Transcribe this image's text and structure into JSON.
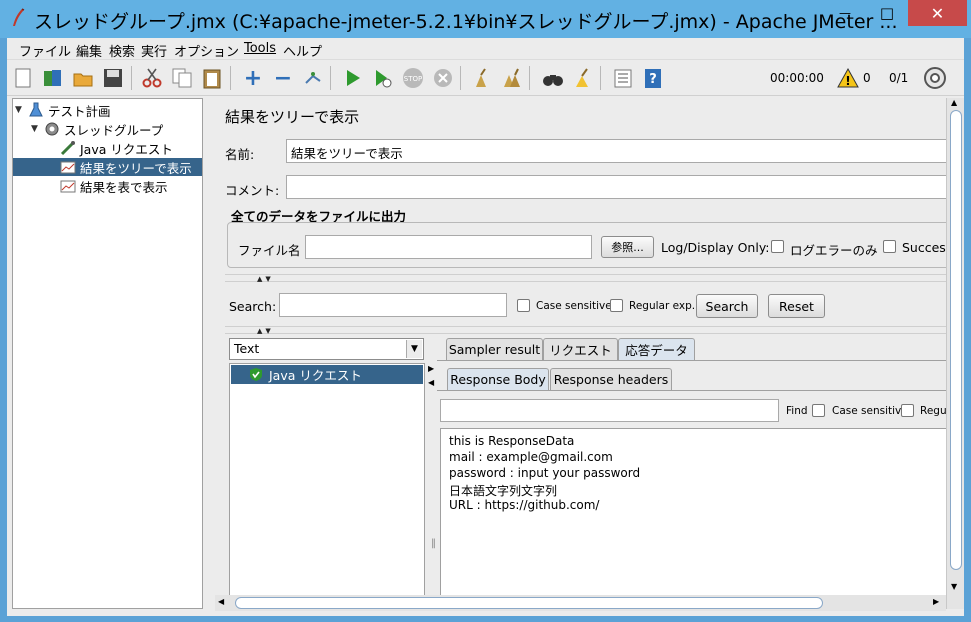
{
  "window": {
    "title": "スレッドグループ.jmx (C:¥apache-jmeter-5.2.1¥bin¥スレッドグループ.jmx) - Apache JMeter ...",
    "minimize": "—",
    "maximize": "□",
    "close": "✕"
  },
  "menu": [
    "ファイル",
    "編集",
    "検索",
    "実行",
    "オプション",
    "Tools",
    "ヘルプ"
  ],
  "toolbar": {
    "timer": "00:00:00",
    "warnings": "0",
    "threads": "0/1"
  },
  "tree": {
    "items": [
      {
        "label": "テスト計画",
        "icon": "flask-icon"
      },
      {
        "label": "スレッドグループ",
        "icon": "gear-icon"
      },
      {
        "label": "Java リクエスト",
        "icon": "pipette-icon"
      },
      {
        "label": "結果をツリーで表示",
        "icon": "chart-icon"
      },
      {
        "label": "結果を表で表示",
        "icon": "chart-icon"
      }
    ],
    "selected_index": 3
  },
  "panel": {
    "title": "結果をツリーで表示",
    "name_label": "名前:",
    "name_value": "結果をツリーで表示",
    "comment_label": "コメント:",
    "comment_value": "",
    "file_section": "全てのデータをファイルに出力",
    "filename_label": "ファイル名",
    "filename_value": "",
    "browse": "参照...",
    "log_display_only": "Log/Display Only:",
    "errors_only": "ログエラーのみ",
    "successes": "Successe"
  },
  "search": {
    "label": "Search:",
    "value": "",
    "case_sensitive": "Case sensitive",
    "regular_exp": "Regular exp.",
    "search_button": "Search",
    "reset_button": "Reset"
  },
  "results": {
    "renderer": "Text",
    "samples": [
      "Java リクエスト"
    ],
    "tabs": [
      "Sampler result",
      "リクエスト",
      "応答データ"
    ],
    "active_tab": "応答データ",
    "subtabs": [
      "Response Body",
      "Response headers"
    ],
    "active_subtab": "Response Body",
    "find_value": "",
    "find_label": "Find",
    "find_case_sensitive": "Case sensitive",
    "find_regu": "Regu",
    "response_lines": [
      "this is ResponseData",
      "mail : example@gmail.com",
      "password : input your password",
      "日本語文字列文字列",
      "URL : https://github.com/"
    ]
  }
}
